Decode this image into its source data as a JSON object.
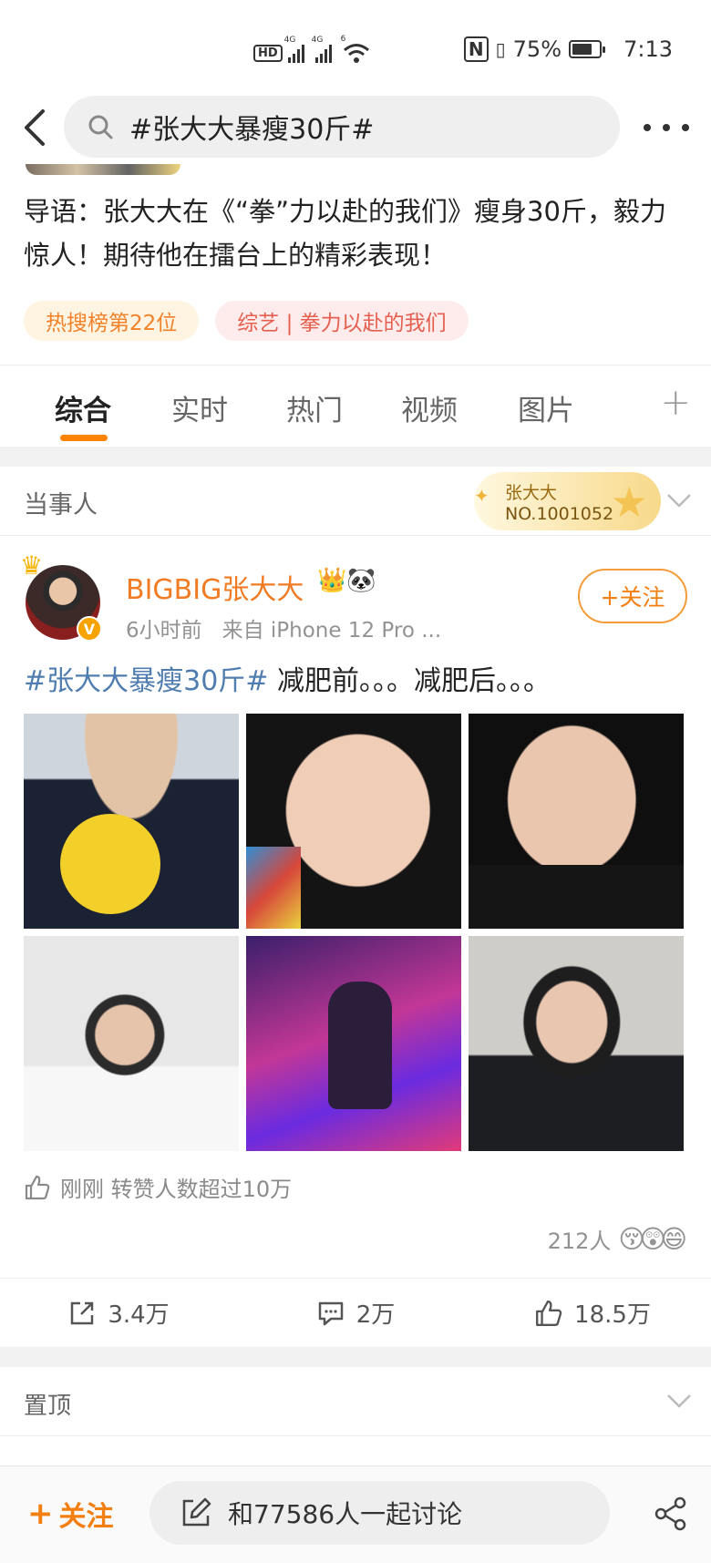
{
  "status_bar": {
    "hd": "HD",
    "sim1": "4G",
    "sim2": "4G",
    "wifi": "6",
    "battery_percent": "75%",
    "battery_level": 0.75,
    "time": "7:13"
  },
  "header": {
    "search_text": "#张大大暴瘦30斤#"
  },
  "intro": {
    "text": "导语：张大大在《“拳”力以赴的我们》瘦身30斤，毅力惊人！期待他在擂台上的精彩表现！",
    "tags": [
      {
        "label": "热搜榜第22位"
      },
      {
        "label": "综艺 | 拳力以赴的我们"
      }
    ]
  },
  "tabs": [
    {
      "label": "综合",
      "active": true
    },
    {
      "label": "实时"
    },
    {
      "label": "热门"
    },
    {
      "label": "视频"
    },
    {
      "label": "图片"
    }
  ],
  "party": {
    "label": "当事人",
    "rank_name": "张大大",
    "rank_no": "NO.1001052"
  },
  "post": {
    "author": "BIGBIG张大大",
    "verified_mark": "V",
    "author_emojis": "👑🐼",
    "time": "6小时前",
    "source": "来自 iPhone 12 Pro ...",
    "follow_label": "+关注",
    "topic": "#张大大暴瘦30斤#",
    "text": " 减肥前。。。减肥后。。。",
    "repost_note": "刚刚 转赞人数超过10万",
    "likers_count": "212人",
    "liker_emojis": [
      "😚",
      "😲",
      "😄"
    ],
    "actions": {
      "repost": "3.4万",
      "comment": "2万",
      "like": "18.5万"
    }
  },
  "pinned": {
    "label": "置顶"
  },
  "bottom_bar": {
    "follow_label": "关注",
    "discuss_text": "和77586人一起讨论"
  },
  "colors": {
    "accent": "#ff8200",
    "author": "#f07b22",
    "topic": "#507daf"
  }
}
